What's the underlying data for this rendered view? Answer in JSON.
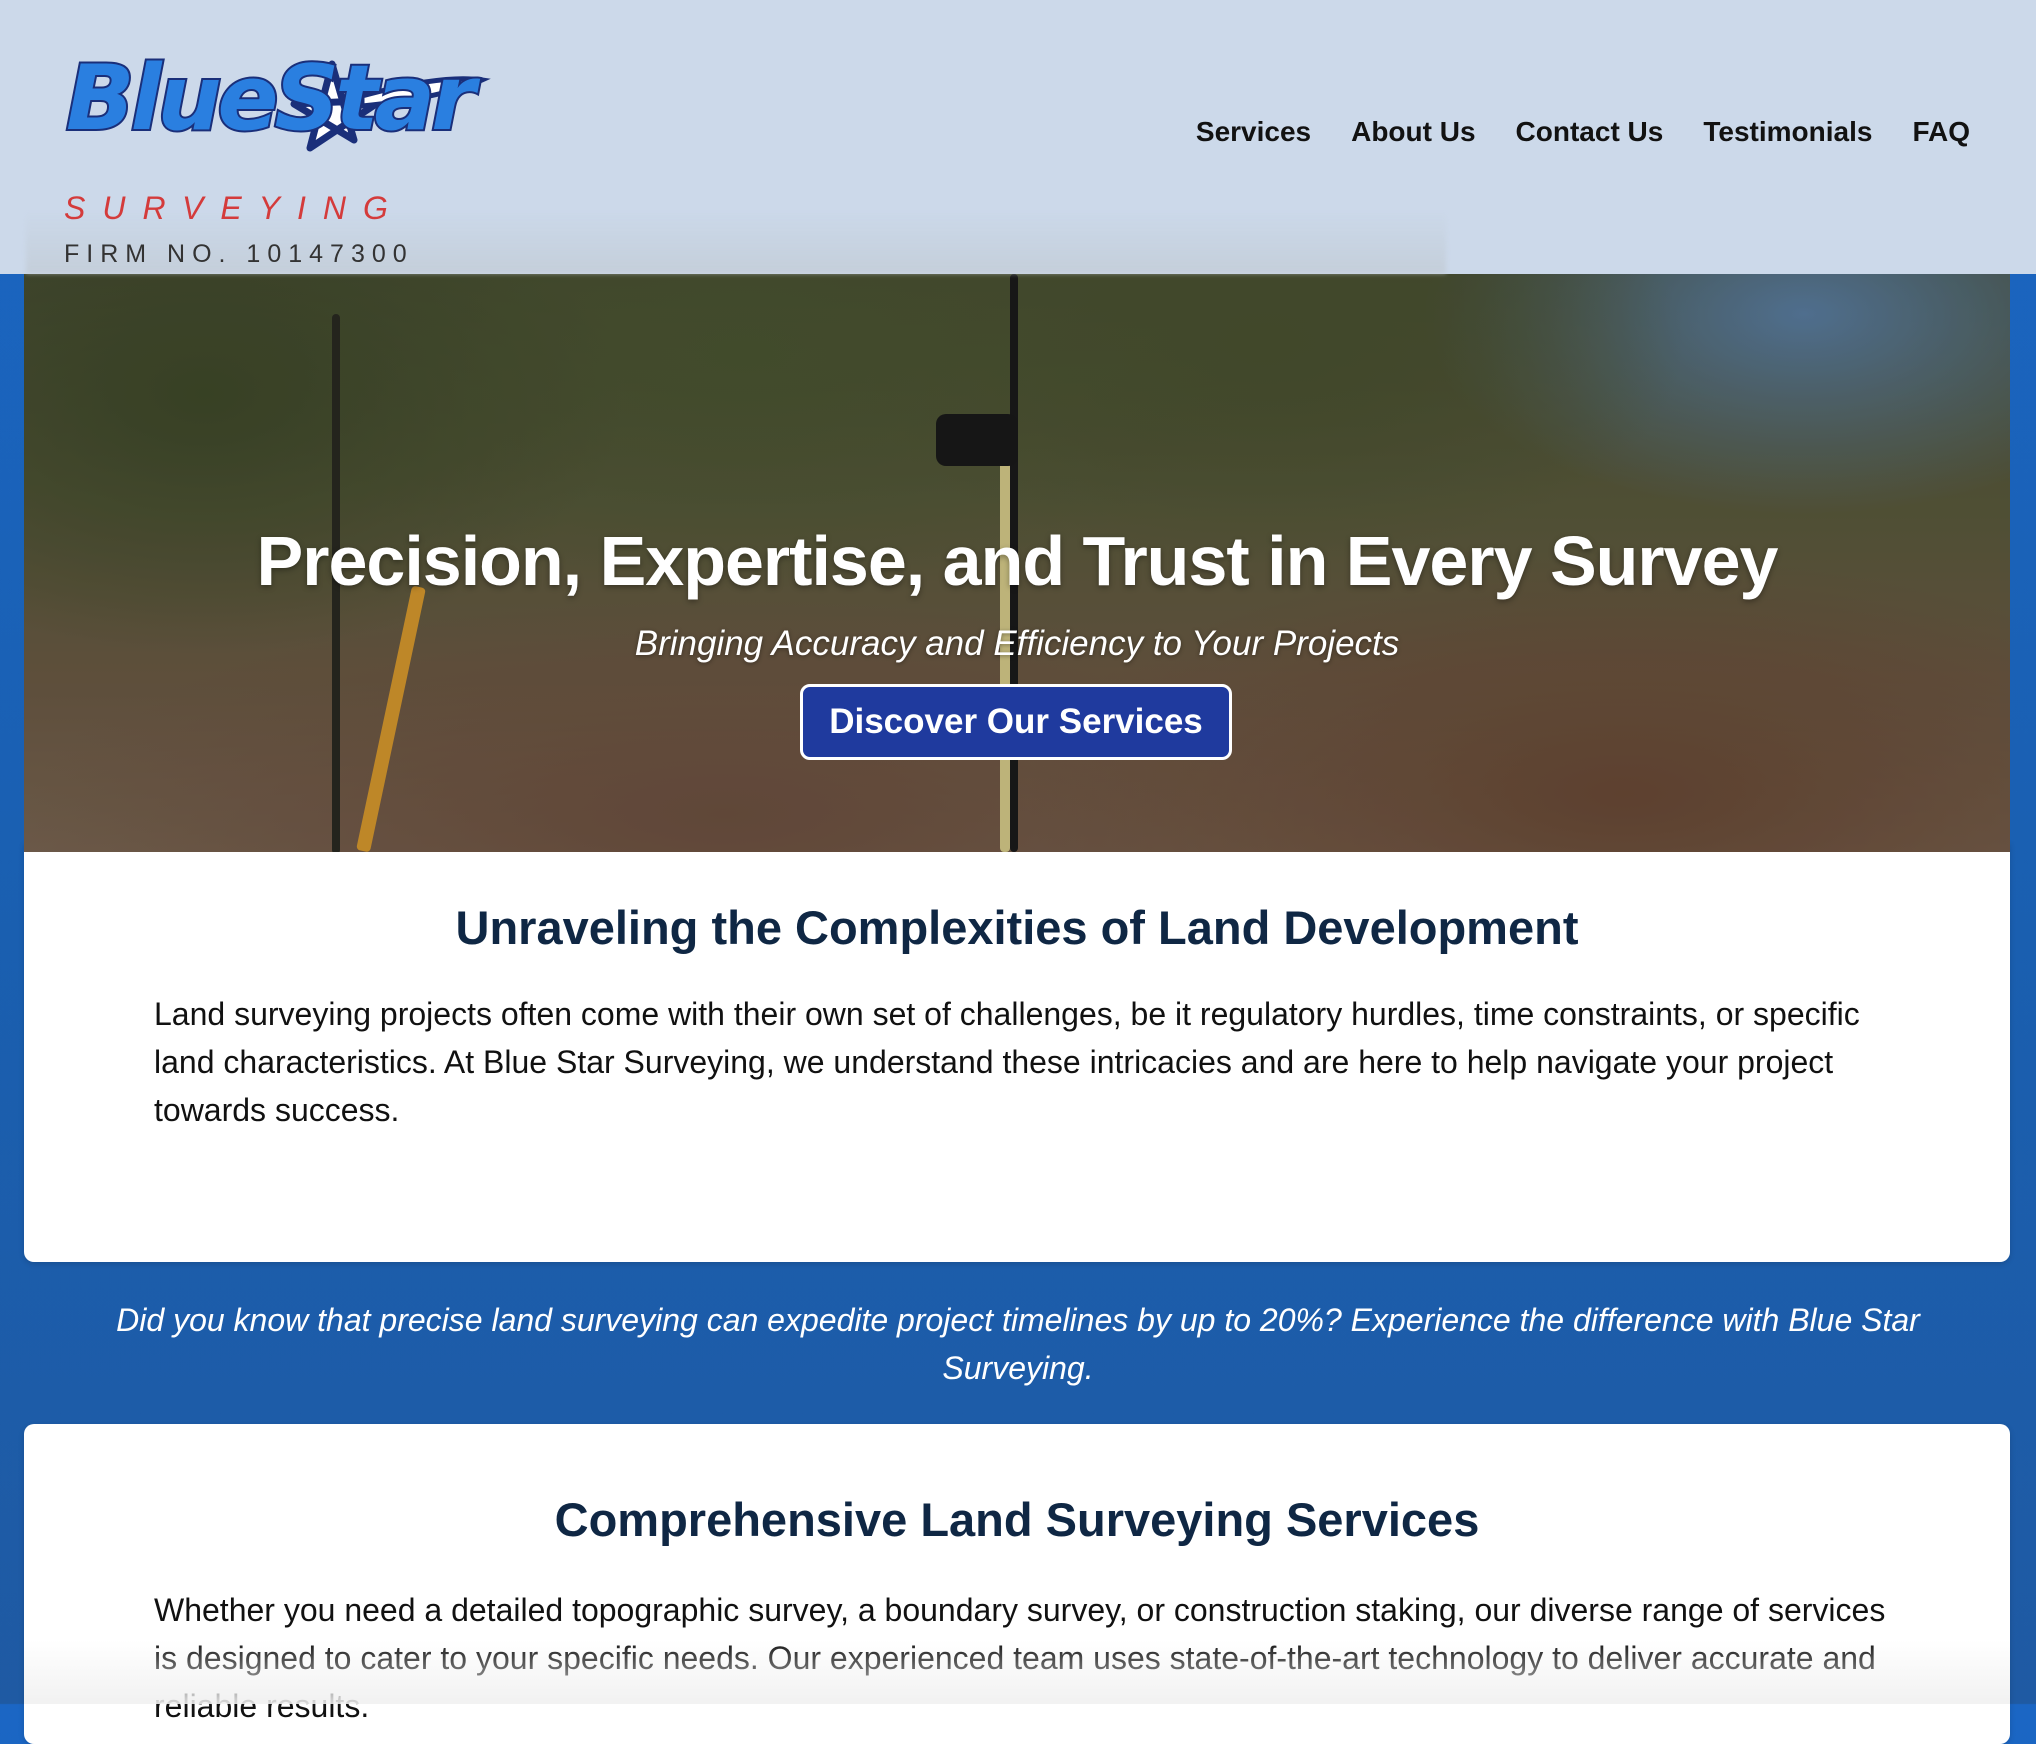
{
  "brand": {
    "wordmark": "BlueStar",
    "sub": "SURVEYING",
    "firm_number": "FIRM NO. 10147300",
    "colors": {
      "blue": "#2a7fe0",
      "navy": "#1a2f7a",
      "red": "#d43b3b"
    }
  },
  "nav": {
    "items": [
      {
        "label": "Services"
      },
      {
        "label": "About Us"
      },
      {
        "label": "Contact Us"
      },
      {
        "label": "Testimonials"
      },
      {
        "label": "FAQ"
      }
    ]
  },
  "hero": {
    "title": "Precision, Expertise, and Trust in Every Survey",
    "subtitle": "Bringing Accuracy and Efficiency to Your Projects",
    "cta_label": "Discover Our Services",
    "cta_color": "#1f3a9e"
  },
  "section_complexities": {
    "heading": "Unraveling the Complexities of Land Development",
    "body": "Land surveying projects often come with their own set of challenges, be it regulatory hurdles, time constraints, or specific land characteristics. At Blue Star Surveying, we understand these intricacies and are here to help navigate your project towards success."
  },
  "fact_banner": {
    "text": "Did you know that precise land surveying can expedite project timelines by up to 20%? Experience the difference with Blue Star Surveying."
  },
  "section_services": {
    "heading": "Comprehensive Land Surveying Services",
    "body": "Whether you need a detailed topographic survey, a boundary survey, or construction staking, our diverse range of services is designed to cater to your specific needs. Our experienced team uses state-of-the-art technology to deliver accurate and reliable results."
  }
}
